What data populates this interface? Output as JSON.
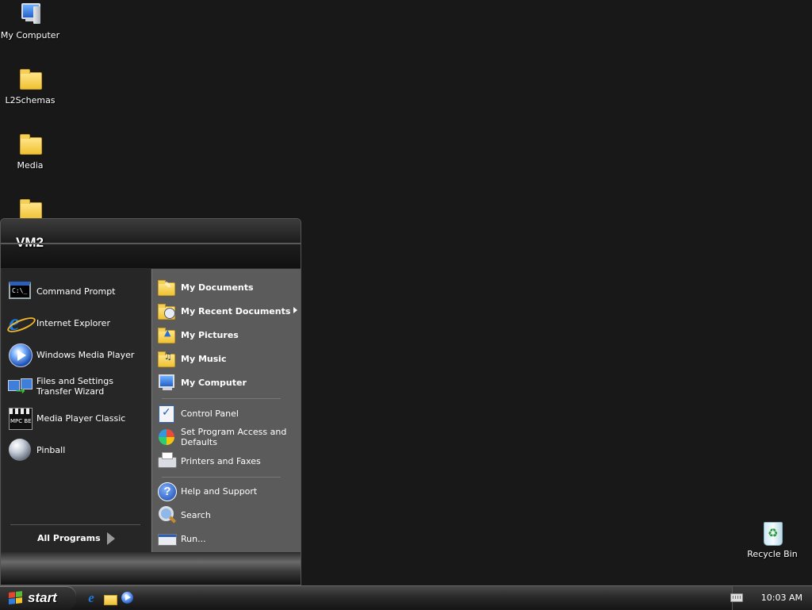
{
  "desktop": {
    "icons": [
      {
        "label": "My Computer",
        "icon": "my-computer-icon"
      },
      {
        "label": "L2Schemas",
        "icon": "folder-icon"
      },
      {
        "label": "Media",
        "icon": "folder-icon"
      },
      {
        "label": "",
        "icon": "folder-icon"
      },
      {
        "label": "Recycle Bin",
        "icon": "recycle-bin-icon"
      }
    ]
  },
  "start_menu": {
    "user_name": "VM2",
    "pinned_programs": [
      {
        "label": "Command Prompt",
        "icon": "command-prompt-icon"
      },
      {
        "label": "Internet Explorer",
        "icon": "internet-explorer-icon"
      },
      {
        "label": "Windows Media Player",
        "icon": "windows-media-player-icon"
      },
      {
        "label": "Files and Settings Transfer Wizard",
        "icon": "transfer-wizard-icon"
      },
      {
        "label": "Media Player Classic",
        "icon": "media-player-classic-icon"
      },
      {
        "label": "Pinball",
        "icon": "pinball-icon"
      }
    ],
    "all_programs_label": "All Programs",
    "places": [
      {
        "label": "My Documents",
        "icon": "my-documents-icon"
      },
      {
        "label": "My Recent Documents",
        "icon": "my-recent-documents-icon"
      },
      {
        "label": "My Pictures",
        "icon": "my-pictures-icon"
      },
      {
        "label": "My Music",
        "icon": "my-music-icon"
      },
      {
        "label": "My Computer",
        "icon": "my-computer-icon"
      }
    ],
    "settings": [
      {
        "label": "Control Panel",
        "icon": "control-panel-icon"
      },
      {
        "label": "Set Program Access and Defaults",
        "icon": "program-access-icon"
      },
      {
        "label": "Printers and Faxes",
        "icon": "printer-icon"
      }
    ],
    "tools": [
      {
        "label": "Help and Support",
        "icon": "help-icon"
      },
      {
        "label": "Search",
        "icon": "search-icon"
      },
      {
        "label": "Run...",
        "icon": "run-icon"
      }
    ]
  },
  "taskbar": {
    "start_label": "start",
    "quick_launch": [
      {
        "icon": "internet-explorer-icon"
      },
      {
        "icon": "windows-explorer-icon"
      },
      {
        "icon": "windows-media-player-icon"
      }
    ],
    "clock": "10:03 AM",
    "tray_icons": [
      {
        "icon": "keyboard-icon"
      }
    ]
  }
}
